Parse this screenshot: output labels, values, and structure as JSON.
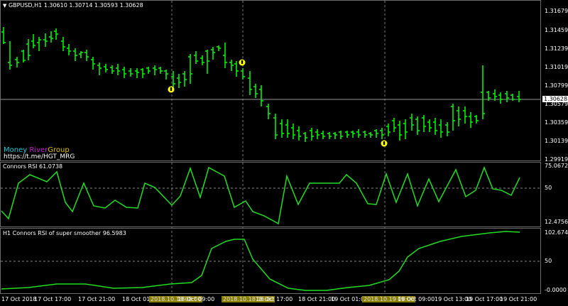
{
  "main": {
    "symbol_title": "GBPUSD,H1  1.30610 1.30714 1.30593 1.30628",
    "price_axis": [
      "1.31679",
      "1.31459",
      "1.31239",
      "1.31019",
      "1.30799",
      "1.30579",
      "1.30359",
      "1.30139",
      "1.29919"
    ],
    "current_price": "1.30628",
    "brand": {
      "word1": "Money",
      "word2": "River",
      "word3": "Group",
      "link": "https://t.me/HGT_MRG",
      "color1": "#23c6d6",
      "color2": "#c21fd1",
      "color3": "#e0c000"
    },
    "candle_color": "#00ff00",
    "marker_color": "#ffff00"
  },
  "rsi": {
    "title": "Connors RSI 61.0738",
    "axis": {
      "top": "75.0672",
      "mid": "50",
      "bottom": "12.4756"
    },
    "line_color": "#22dd22"
  },
  "smoother": {
    "title": "H1 Connors RSI of super smoother 96.5983",
    "axis": {
      "top": "102.6748",
      "mid": "50",
      "bottom": "-0.0000"
    },
    "line_color": "#22dd22"
  },
  "time_axis": [
    {
      "label": "17 Oct 2018"
    },
    {
      "label": "17 Oct 17:00"
    },
    {
      "label": "17 Oct 21:00"
    },
    {
      "label": "18 Oct 01:00"
    },
    {
      "label": "2018.10.18 08:00",
      "highlight": true
    },
    {
      "label": "18 Oct 09:00"
    },
    {
      "label": "2018.10.18 16:00",
      "highlight": true
    },
    {
      "label": "18 Oct 17:00"
    },
    {
      "label": "18 Oct 21:00"
    },
    {
      "label": "19 Oct 01:00"
    },
    {
      "label": "2018.10.19 08:00",
      "highlight": true
    },
    {
      "label": "19 Oct 09:00"
    },
    {
      "label": "19 Oct 13:00"
    },
    {
      "label": "19 Oct 17:00"
    },
    {
      "label": "19 Oct 21:00"
    }
  ]
}
